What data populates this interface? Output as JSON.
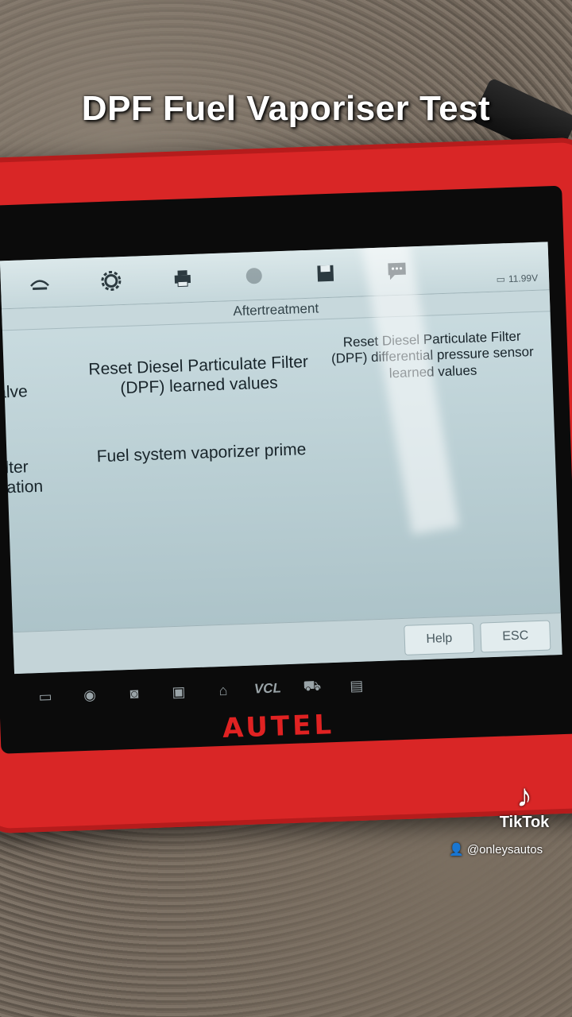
{
  "overlay": {
    "title": "DPF Fuel Vaporiser Test"
  },
  "toolbar": {
    "buttons": [
      "vehicle-lift-icon",
      "settings-icon",
      "print-icon",
      "disabled-icon",
      "save-icon",
      "message-icon"
    ],
    "battery": "11.99V"
  },
  "screen": {
    "section_title": "Aftertreatment",
    "items": [
      {
        "label": "s\nvalve"
      },
      {
        "label": "Reset Diesel Particulate Filter (DPF) learned values"
      },
      {
        "label": "Reset Diesel Particulate Filter (DPF) differential pressure sensor learned values"
      },
      {
        "label": "Filter\neration"
      },
      {
        "label": "Fuel system vaporizer prime"
      }
    ],
    "help_label": "Help",
    "esc_label": "ESC"
  },
  "navbar": {
    "vcl_label": "VCL",
    "icons": [
      "window-icon",
      "chrome-icon",
      "camera-icon",
      "screen-record-icon",
      "home-icon",
      "vcl-icon",
      "car-icon",
      "pro-icon"
    ]
  },
  "device": {
    "brand": "AUTEL"
  },
  "watermark": {
    "app": "TikTok",
    "handle": "@onleysautos"
  },
  "colors": {
    "device_red": "#d92626",
    "screen_bg": "#cfe0e4"
  }
}
